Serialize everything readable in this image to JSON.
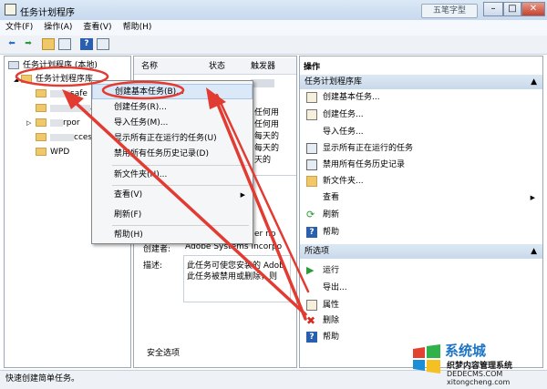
{
  "window": {
    "title": "任务计划程序",
    "watermark_badge": "五笔字型"
  },
  "menubar": [
    "文件(F)",
    "操作(A)",
    "查看(V)",
    "帮助(H)"
  ],
  "tree": {
    "root": "任务计划程序 (本地)",
    "library": "任务计划程序库",
    "children": [
      "safe",
      "ark",
      "rpor",
      "ccess",
      "WPD"
    ]
  },
  "table": {
    "columns": [
      "名称",
      "状态",
      "触发器"
    ],
    "status_fragments": [
      "任何用",
      "任何用",
      "每天的",
      "每天的",
      "天的"
    ]
  },
  "details": {
    "author_label": "创建者:",
    "author_value": "Adobe Systems Incorpo",
    "desc_label": "描述:",
    "desc_line1": "此任务可使您安装的 Adob",
    "desc_line2": "此任务被禁用或删除，则",
    "security_label": "安全选项",
    "trigger_fragment": "er np"
  },
  "context_menu": {
    "items": [
      "创建基本任务(B)...",
      "创建任务(R)...",
      "导入任务(M)...",
      "显示所有正在运行的任务(U)",
      "禁用所有任务历史记录(D)",
      "新文件夹(N)...",
      "查看(V)",
      "刷新(F)",
      "帮助(H)"
    ]
  },
  "actions": {
    "header": "操作",
    "section1": "任务计划程序库",
    "items1": [
      "创建基本任务...",
      "创建任务...",
      "导入任务...",
      "显示所有正在运行的任务",
      "禁用所有任务历史记录",
      "新文件夹...",
      "查看",
      "刷新",
      "帮助"
    ],
    "section2": "所选项",
    "items2": [
      "运行",
      "导出...",
      "属性",
      "删除",
      "帮助"
    ]
  },
  "statusbar": "快速创建简单任务。",
  "logo": {
    "title": "系统城",
    "subtitle": "织梦内容管理系统",
    "url1": "DEDECMS.COM",
    "url2": "xitongcheng.com"
  },
  "colors": {
    "accent": "#1b74c6",
    "arrow": "#e23b32",
    "titlebar": "#c7d9ee"
  }
}
